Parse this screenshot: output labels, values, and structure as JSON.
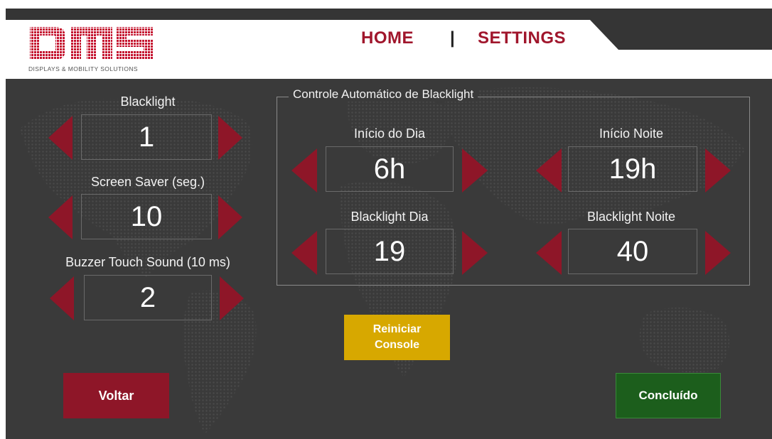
{
  "header": {
    "logo_text": "DMS",
    "logo_subtitle": "DISPLAYS  &  MOBILITY  SOLUTIONS",
    "nav_home": "HOME",
    "nav_separator": "|",
    "nav_settings": "SETTINGS"
  },
  "left_panel": {
    "blacklight": {
      "label": "Blacklight",
      "value": "1"
    },
    "screen_saver": {
      "label": "Screen Saver  (seg.)",
      "value": "10"
    },
    "buzzer": {
      "label": "Buzzer Touch Sound (10 ms)",
      "value": "2"
    }
  },
  "auto_control": {
    "title": "Controle Automático de Blacklight",
    "inicio_dia": {
      "label": "Início do Dia",
      "value": "6h"
    },
    "inicio_noite": {
      "label": "Início Noite",
      "value": "19h"
    },
    "blacklight_dia": {
      "label": "Blacklight Dia",
      "value": "19"
    },
    "blacklight_noite": {
      "label": "Blacklight Noite",
      "value": "40"
    }
  },
  "buttons": {
    "reiniciar_line1": "Reiniciar",
    "reiniciar_line2": "Console",
    "voltar": "Voltar",
    "concluido": "Concluído"
  },
  "colors": {
    "accent_red": "#a0162c",
    "arrow_red": "#8e1628",
    "panel_bg": "#3a3a3a",
    "reiniciar_yellow": "#d7a800",
    "concluido_green": "#1c5e1c"
  },
  "icons": {
    "decrement": "triangle-left-icon",
    "increment": "triangle-right-icon",
    "background": "world-map-dots"
  }
}
